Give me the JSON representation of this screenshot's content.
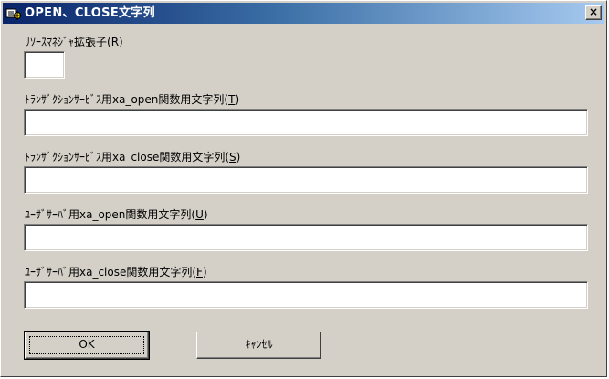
{
  "window": {
    "title": "OPEN、CLOSE文字列",
    "close_label": "×"
  },
  "fields": {
    "rm_ext": {
      "label_prefix": "ﾘｿｰｽﾏﾈｼﾞｬ拡張子(",
      "mnemonic": "R",
      "label_suffix": ")",
      "value": ""
    },
    "ts_open": {
      "label_prefix": "ﾄﾗﾝｻﾞｸｼｮﾝｻｰﾋﾞｽ用xa_open関数用文字列(",
      "mnemonic": "T",
      "label_suffix": ")",
      "value": ""
    },
    "ts_close": {
      "label_prefix": "ﾄﾗﾝｻﾞｸｼｮﾝｻｰﾋﾞｽ用xa_close関数用文字列(",
      "mnemonic": "S",
      "label_suffix": ")",
      "value": ""
    },
    "us_open": {
      "label_prefix": "ﾕｰｻﾞｻｰﾊﾞ用xa_open関数用文字列(",
      "mnemonic": "U",
      "label_suffix": ")",
      "value": ""
    },
    "us_close": {
      "label_prefix": "ﾕｰｻﾞｻｰﾊﾞ用xa_close関数用文字列(",
      "mnemonic": "F",
      "label_suffix": ")",
      "value": ""
    }
  },
  "buttons": {
    "ok_label": "OK",
    "cancel_label": "ｷｬﾝｾﾙ"
  }
}
